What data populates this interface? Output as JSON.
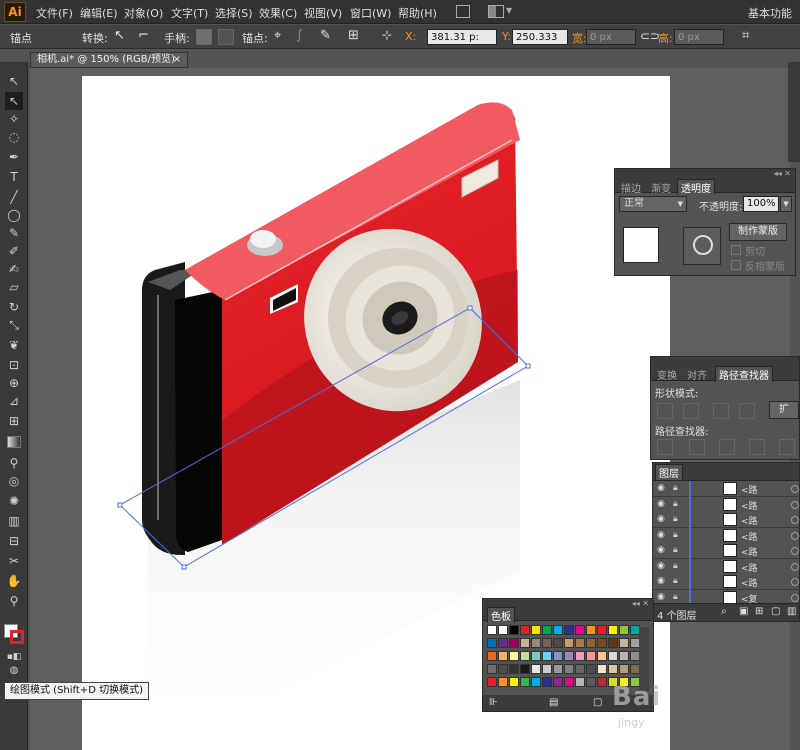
{
  "app": {
    "logo": "Ai",
    "workspace": "基本功能"
  },
  "menu": [
    "文件(F)",
    "编辑(E)",
    "对象(O)",
    "文字(T)",
    "选择(S)",
    "效果(C)",
    "视图(V)",
    "窗口(W)",
    "帮助(H)"
  ],
  "options_bar": {
    "tool_label": "锚点",
    "convert_label": "转换:",
    "handles_label": "手柄:",
    "anchor_label": "锚点:",
    "x_label": "X:",
    "x_value": "381.31 p:",
    "y_label": "Y:",
    "y_value": "250.333",
    "w_label": "宽:",
    "w_value": "0 px",
    "h_label": "高:",
    "h_value": "0 px"
  },
  "document_tab": {
    "title": "相机.ai* @ 150% (RGB/预览)",
    "close": "×"
  },
  "tooltip": "绘图模式 (Shift+D 切换模式)",
  "transparency_panel": {
    "tabs": [
      "描边",
      "渐变",
      "透明度"
    ],
    "blend_mode": "正常",
    "opacity_label": "不透明度:",
    "opacity_value": "100%",
    "make_mask_button": "制作蒙版",
    "clip_label": "剪切",
    "invert_mask_label": "反相蒙版"
  },
  "pathfinder_panel": {
    "tabs": [
      "变换",
      "对齐",
      "路径查找器"
    ],
    "shape_modes_label": "形状模式:",
    "pathfinders_label": "路径查找器:",
    "expand_button": "扩"
  },
  "layers_panel": {
    "tab": "图层",
    "rows": [
      {
        "name": "<路",
        "thumb": "#ffffff"
      },
      {
        "name": "<路",
        "thumb": "#ffffff"
      },
      {
        "name": "<路",
        "thumb": "#ffffff"
      },
      {
        "name": "<路",
        "thumb": "#ffffff"
      },
      {
        "name": "<路",
        "thumb": "#111111"
      },
      {
        "name": "<路",
        "thumb": "#e0202a"
      },
      {
        "name": "<路",
        "thumb": "#dddddd"
      },
      {
        "name": "<复",
        "thumb": "#f4f4f4"
      }
    ],
    "count_label": "4 个图层"
  },
  "swatches_panel": {
    "tab": "色板"
  },
  "watermark": {
    "brand": "Bai",
    "sub": "jingy"
  },
  "colors": {
    "camera_red": "#e0202a",
    "camera_top": "#f25a62",
    "camera_dark": "#111111",
    "lens_cream": "#efeae0",
    "selection": "#4a6fe0"
  }
}
